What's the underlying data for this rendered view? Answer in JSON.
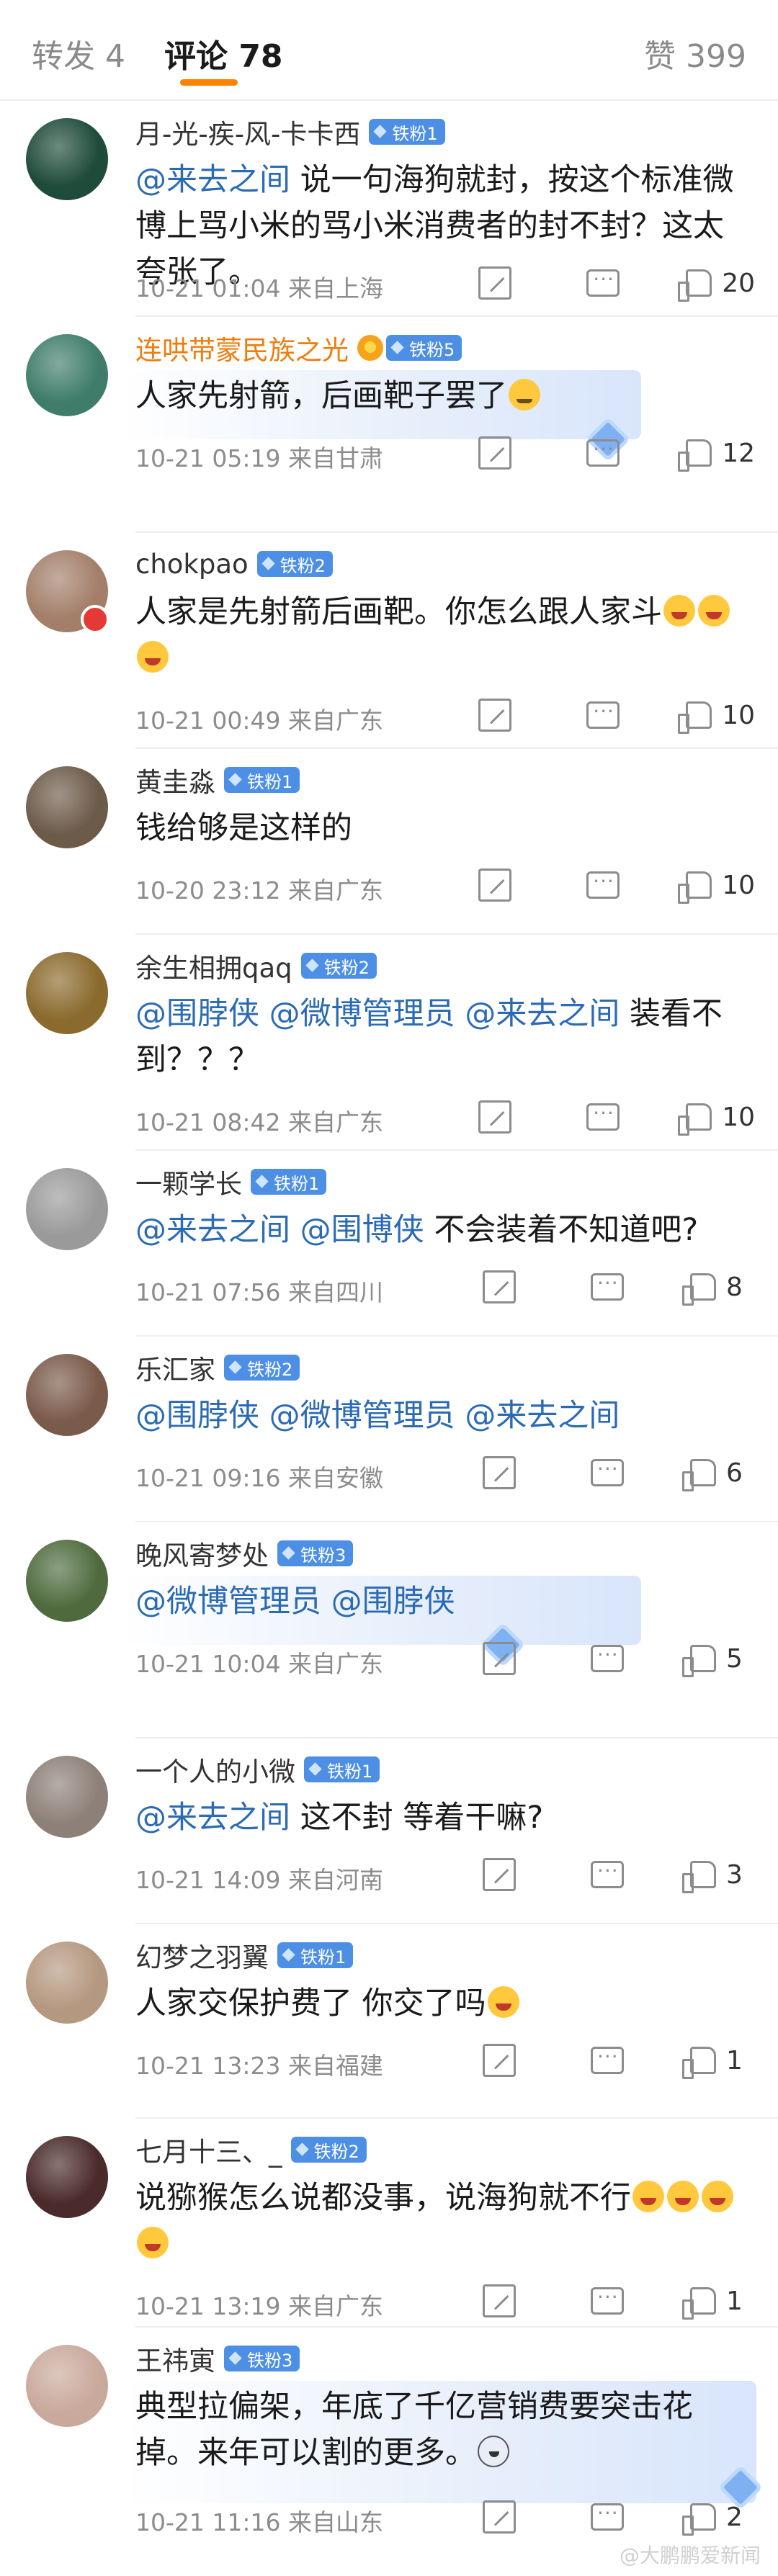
{
  "tabs": {
    "repost": "转发 4",
    "comments": "评论 78",
    "likes": "赞 399"
  },
  "comments": [
    {
      "user": "月-光-疾-风-卡卡西",
      "fan": "铁粉1",
      "body": [
        {
          "m": "@来去之间"
        },
        {
          "t": " 说一句海狗就封，按这个标准微博上骂小米的骂小米消费者的封不封？这太夸张了。"
        }
      ],
      "time": "10-21 01:04",
      "loc": "来自上海",
      "likes": "20"
    },
    {
      "user": "连哄带蒙民族之光",
      "fan": "铁粉5",
      "gold": true,
      "body": [
        {
          "t": "人家先射箭，后画靶子罢了"
        },
        {
          "e": "sweat"
        }
      ],
      "time": "10-21 05:19",
      "loc": "来自甘肃",
      "likes": "12"
    },
    {
      "user": "chokpao",
      "fan": "铁粉2",
      "body": [
        {
          "t": "人家是先射箭后画靶。你怎么跟人家斗"
        },
        {
          "e": "laugh"
        },
        {
          "e": "laugh"
        },
        {
          "e": "laugh"
        }
      ],
      "time": "10-21 00:49",
      "loc": "来自广东",
      "likes": "10"
    },
    {
      "user": "黄圭淼",
      "fan": "铁粉1",
      "body": [
        {
          "t": "钱给够是这样的"
        }
      ],
      "time": "10-20 23:12",
      "loc": "来自广东",
      "likes": "10"
    },
    {
      "user": "余生相拥qaq",
      "fan": "铁粉2",
      "body": [
        {
          "m": "@围脖侠"
        },
        {
          "t": " "
        },
        {
          "m": "@微博管理员"
        },
        {
          "t": " "
        },
        {
          "m": "@来去之间"
        },
        {
          "t": " 装看不到？？？"
        }
      ],
      "time": "10-21 08:42",
      "loc": "来自广东",
      "likes": "10"
    },
    {
      "user": "一颗学长",
      "fan": "铁粉1",
      "body": [
        {
          "m": "@来去之间"
        },
        {
          "t": " "
        },
        {
          "m": "@围博侠"
        },
        {
          "t": " 不会装着不知道吧?"
        }
      ],
      "time": "10-21 07:56",
      "loc": "来自四川",
      "likes": "8"
    },
    {
      "user": "乐汇家",
      "fan": "铁粉2",
      "body": [
        {
          "m": "@围脖侠"
        },
        {
          "t": " "
        },
        {
          "m": "@微博管理员"
        },
        {
          "t": " "
        },
        {
          "m": "@来去之间"
        }
      ],
      "time": "10-21 09:16",
      "loc": "来自安徽",
      "likes": "6"
    },
    {
      "user": "晚风寄梦处",
      "fan": "铁粉3",
      "body": [
        {
          "m": "@微博管理员"
        },
        {
          "t": " "
        },
        {
          "m": "@围脖侠"
        }
      ],
      "time": "10-21 10:04",
      "loc": "来自广东",
      "likes": "5"
    },
    {
      "user": "一个人的小微",
      "fan": "铁粉1",
      "body": [
        {
          "m": "@来去之间"
        },
        {
          "t": "   这不封  等着干嘛?"
        }
      ],
      "time": "10-21 14:09",
      "loc": "来自河南",
      "likes": "3"
    },
    {
      "user": "幻梦之羽翼",
      "fan": "铁粉1",
      "body": [
        {
          "t": "人家交保护费了 你交了吗"
        },
        {
          "e": "laugh"
        }
      ],
      "time": "10-21 13:23",
      "loc": "来自福建",
      "likes": "1"
    },
    {
      "user": "七月十三、_",
      "fan": "铁粉2",
      "body": [
        {
          "t": "说猕猴怎么说都没事，说海狗就不行"
        },
        {
          "e": "laugh"
        },
        {
          "e": "laugh"
        },
        {
          "e": "laugh"
        },
        {
          "e": "laugh"
        }
      ],
      "time": "10-21 13:19",
      "loc": "来自广东",
      "likes": "1"
    },
    {
      "user": "王祎寅",
      "fan": "铁粉3",
      "body": [
        {
          "t": "典型拉偏架，年底了千亿营销费要突击花掉。来年可以割的更多。"
        },
        {
          "e": "dog"
        }
      ],
      "time": "10-21 11:16",
      "loc": "来自山东",
      "likes": "2"
    }
  ],
  "watermark": "@大鹏鹏爱新闻",
  "colors": {
    "accent": "#ff8200",
    "mention": "#2b6bb3",
    "fan_badge": "#4d8fe4",
    "gold_name": "#f07c0b"
  }
}
